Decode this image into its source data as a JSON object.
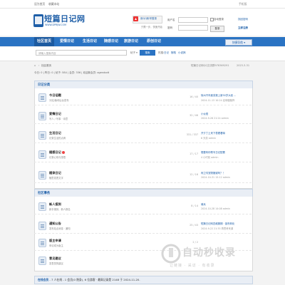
{
  "topbar": {
    "set_home": "设为首页",
    "bookmark": "收藏本站",
    "mobile": "手机版",
    "mobile_icon": "mobile-icon"
  },
  "header": {
    "site_name": "短篇日记网",
    "site_url": "WWW.DPRJW.COM",
    "qq_login": "用QQ帐号登录",
    "quick_login": "只需一步，快速开始",
    "username_label": "用户名",
    "auto_login": "自动登录",
    "find_password": "找回密码",
    "password_label": "密码",
    "login_button": "登录",
    "register": "立即注册"
  },
  "nav": {
    "items": [
      {
        "label": "社区首页",
        "active": true
      },
      {
        "label": "爱情日记",
        "active": false
      },
      {
        "label": "生活日记",
        "active": false
      },
      {
        "label": "随感日记",
        "active": false
      },
      {
        "label": "旅游日记",
        "active": false
      },
      {
        "label": "原创日记",
        "active": false
      }
    ],
    "quick_nav": "快捷导航 ▾"
  },
  "search": {
    "placeholder": "请输入搜索内容",
    "scope": "帖子 ▾",
    "button": "搜索",
    "hot_label": "热搜:",
    "hot_words": [
      "日记",
      "随笔",
      "小说搞"
    ]
  },
  "breadcrumb": {
    "home_icon": "home-icon",
    "current": "社区首页",
    "notice": "短篇日记网QQ交流群978369291",
    "date": "2023-3-31"
  },
  "stats": {
    "text": "今日: 0 | 昨日: 0 | 帖子: 584 | 会员: 336 | 欢迎新会员: agendodt"
  },
  "sections": [
    {
      "title": "日记分类",
      "forums": [
        {
          "name": "今日话题",
          "desc": "分站/版块后台发布",
          "count": "16 / 40",
          "last_title": "徐州汽车疲劳报上新30岁大叔 ...",
          "last_meta": "2024-11-13 10:24 足球健脑锋",
          "new": false
        },
        {
          "name": "爱情日记",
          "desc": "写人 / 写事 · 诗意",
          "count": "32 / 46",
          "last_title": "小伙视",
          "last_meta": "2024-9-26 21:24 admin",
          "new": false
        },
        {
          "name": "生活日记",
          "desc": "记录生活的点滴",
          "count": "331 / 337",
          "last_title": "开夕丁土来下表看看嘛",
          "last_meta": "6 天前 admin",
          "new": false
        },
        {
          "name": "随感日记",
          "desc": "记录心情与感悟",
          "count": "17 / 17",
          "last_title": "想要有你帮写日记配置",
          "last_meta": "4 小时前 admin",
          "new": true
        },
        {
          "name": "随录日记",
          "desc": "随意发表文字",
          "count": "12 / 16",
          "last_title": "丙卫沟宠物猪谢吗？！",
          "last_meta": "2024-10-31 15:12 admin",
          "new": false
        }
      ]
    },
    {
      "title": "社区事务",
      "forums": [
        {
          "name": "新人报到",
          "desc": "新手报到，新人报名",
          "count": "8 / 14",
          "last_title": "骑兵",
          "last_meta": "2024-10-28 14:08 admin",
          "new": false
        },
        {
          "name": "通知公告",
          "desc": "发布站点消息 · 通知",
          "count": "25 / 43",
          "last_title": "短篇日记网四维服期 · 宣布转化",
          "last_meta": "2024-9-22 21:35 再思考来源",
          "new": false
        },
        {
          "name": "版主申请",
          "desc": "申请成为版主",
          "count": "2 / 2",
          "last_title": "",
          "last_meta": "",
          "new": false
        },
        {
          "name": "意见建议",
          "desc": "发表您的建议",
          "count": "",
          "last_title": "",
          "last_meta": "",
          "new": false
        }
      ]
    }
  ],
  "online": {
    "label": "在线会员",
    "text": "- 7 人在线 - 1 会员(0 隐身), 6 位游客 · 最高记录是 2148 于 2024-11-20."
  },
  "watermark": {
    "brand": "自动秒收录",
    "slogan": "让链接 · 采访 · 有收录"
  }
}
